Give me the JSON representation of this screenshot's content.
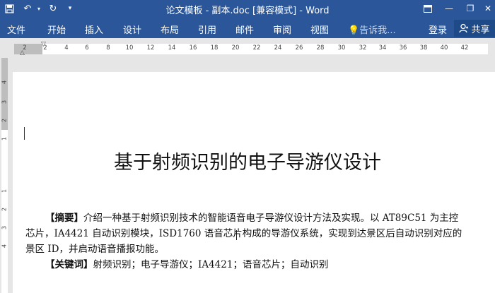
{
  "titlebar": {
    "title": "论文模板 - 副本.doc [兼容模式] - Word",
    "bg": "#2b579a"
  },
  "ribbon": {
    "tabs": [
      "文件",
      "开始",
      "插入",
      "设计",
      "布局",
      "引用",
      "邮件",
      "审阅",
      "视图"
    ],
    "tell_me": "告诉我...",
    "login": "登录",
    "share": "共享"
  },
  "ruler": {
    "h_ticks": [
      "2",
      "2",
      "4",
      "6",
      "8",
      "10",
      "12",
      "14",
      "16",
      "18",
      "20",
      "22",
      "24",
      "26",
      "28",
      "30",
      "32",
      "34",
      "36",
      "38",
      "40",
      "42"
    ],
    "v_ticks": [
      "4",
      "3",
      "2",
      "1",
      "1",
      "2",
      "3",
      "4"
    ]
  },
  "document": {
    "title": "基于射频识别的电子导游仪设计",
    "abstract_label": "【摘要】",
    "abstract_line1": "介绍一种基于射频识别技术的智能语音电子导游仪设计方法及实现。以 AT89C51 为主控",
    "abstract_line2": "芯片，IA4421 自动识别模块，ISD1760 语音芯片构成的导游仪系统，实现到达景区后自动识别对应的",
    "abstract_line3": "景区 ID，并启动语音播报功能。",
    "keywords_label": "【关键词】",
    "keywords": "射频识别；电子导游仪；IA4421；语音芯片；自动识别"
  }
}
